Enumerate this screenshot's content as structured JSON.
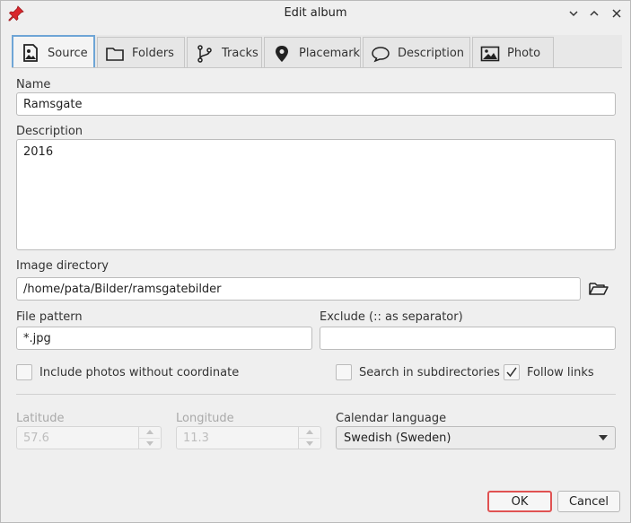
{
  "window": {
    "title": "Edit album"
  },
  "tabs": [
    {
      "label": "Source",
      "icon": "image-icon",
      "active": true
    },
    {
      "label": "Folders",
      "icon": "folder-icon",
      "active": false
    },
    {
      "label": "Tracks",
      "icon": "tracks-icon",
      "active": false
    },
    {
      "label": "Placemark",
      "icon": "placemark-icon",
      "active": false
    },
    {
      "label": "Description",
      "icon": "speech-bubble-icon",
      "active": false
    },
    {
      "label": "Photo",
      "icon": "photo-icon",
      "active": false
    }
  ],
  "form": {
    "name_label": "Name",
    "name_value": "Ramsgate",
    "description_label": "Description",
    "description_value": "2016",
    "image_dir_label": "Image directory",
    "image_dir_value": "/home/pata/Bilder/ramsgatebilder",
    "file_pattern_label": "File pattern",
    "file_pattern_value": "*.jpg",
    "exclude_label": "Exclude (:: as separator)",
    "exclude_value": "",
    "include_no_coord_label": "Include photos without coordinate",
    "include_no_coord_checked": false,
    "search_subdirs_label": "Search in subdirectories",
    "search_subdirs_checked": false,
    "follow_links_label": "Follow links",
    "follow_links_checked": true,
    "latitude_label": "Latitude",
    "latitude_value": "57.6",
    "longitude_label": "Longitude",
    "longitude_value": "11.3",
    "calendar_label": "Calendar language",
    "calendar_value": "Swedish (Sweden)"
  },
  "buttons": {
    "ok": "OK",
    "cancel": "Cancel"
  },
  "colors": {
    "active_tab_border": "#6ea5d6",
    "default_button_border": "#e05252",
    "app_icon": "#d9262c"
  }
}
